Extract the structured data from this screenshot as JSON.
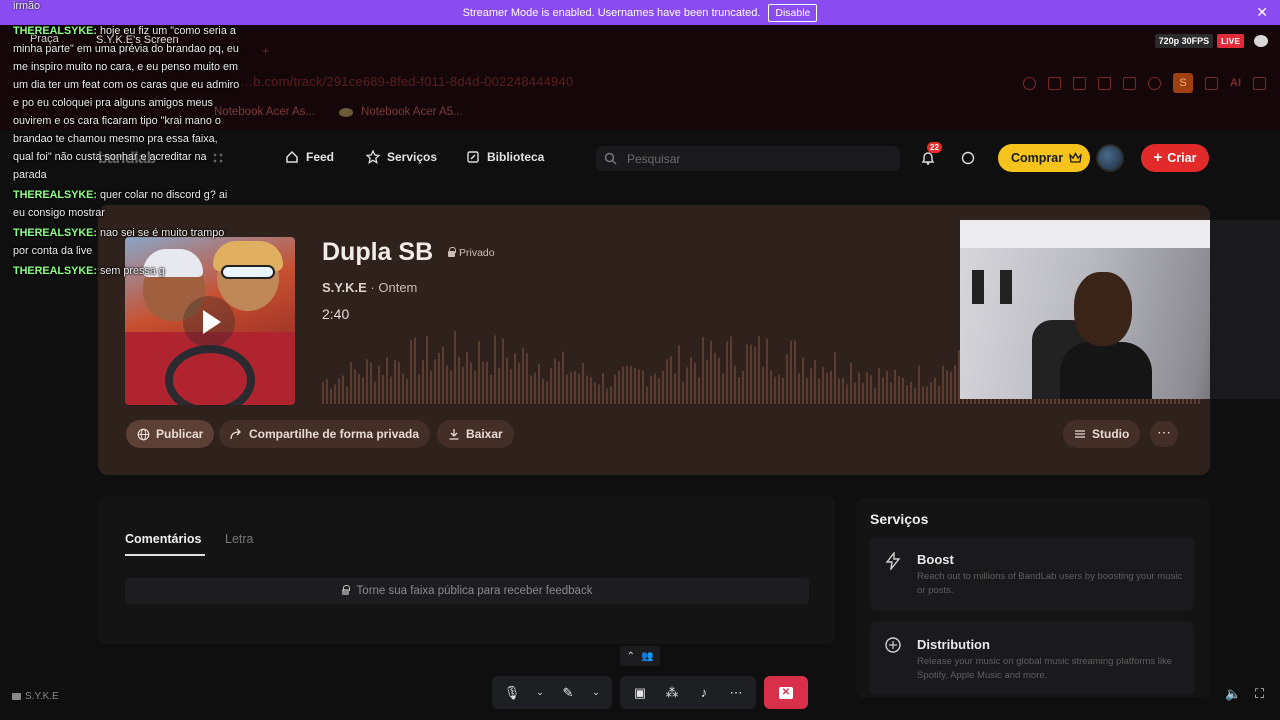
{
  "banner": {
    "message": "Streamer Mode is enabled. Usernames have been truncated.",
    "disable_label": "Disable",
    "close_glyph": "✕"
  },
  "stream": {
    "quality": "720p 30FPS",
    "live": "LIVE",
    "screen_label": "S.Y.K.E's Screen",
    "channel_label": "Praça",
    "user_tag": "S.Y.K.E"
  },
  "browser": {
    "url": "…b.com/track/291ce689-8fed-f011-8d4d-002248444940",
    "bookmarks": [
      "Notebook Acer As...",
      "Notebook Acer A5..."
    ],
    "ai_label": "AI",
    "profile_letter": "S"
  },
  "nav": {
    "logo": "bandlab",
    "links": [
      {
        "label": "Feed",
        "icon": "home-icon"
      },
      {
        "label": "Serviços",
        "icon": "star-icon"
      },
      {
        "label": "Biblioteca",
        "icon": "library-icon"
      }
    ],
    "search_placeholder": "Pesquisar",
    "notification_count": "22",
    "buy_label": "Comprar",
    "create_label": "Criar"
  },
  "track": {
    "title": "Dupla SB",
    "privacy": "Privado",
    "artist": "S.Y.K.E",
    "when": "· Ontem",
    "duration": "2:40",
    "actions": {
      "publish": "Publicar",
      "share_private": "Compartilhe de forma privada",
      "download": "Baixar",
      "studio": "Studio",
      "more": "⋯"
    }
  },
  "comments": {
    "tabs": [
      "Comentários",
      "Letra"
    ],
    "feedback_notice": "Torne sua faixa pública para receber feedback"
  },
  "services": {
    "title": "Serviços",
    "items": [
      {
        "name": "Boost",
        "desc": "Reach out to millions of BandLab users by boosting your music or posts.",
        "icon": "bolt-icon"
      },
      {
        "name": "Distribution",
        "desc": "Release your music on global music streaming platforms like Spotify, Apple Music and more.",
        "icon": "distribution-icon"
      }
    ]
  },
  "chat": {
    "top_fragment": "irmão",
    "messages": [
      {
        "user": "THEREALSYKE:",
        "text": "hoje eu fiz um \"como seria a minha parte\" em uma prévia do brandao pq, eu me inspiro muito no cara, e eu penso muito em um dia ter um feat com os caras que eu admiro e po eu coloquei pra alguns amigos meus ouvirem e os cara ficaram tipo \"krai mano o brandao te chamou mesmo pra essa faixa, qual foi\" não custa sonhar e acreditar na parada"
      },
      {
        "user": "THEREALSYKE:",
        "text": "quer colar no discord g? ai eu consigo mostrar"
      },
      {
        "user": "THEREALSYKE:",
        "text": "nao sei se é muito trampo por conta da live"
      },
      {
        "user": "THEREALSYKE:",
        "text": "sem pressa g"
      }
    ]
  },
  "colors": {
    "banner": "#8a4cf1",
    "card": "#2f211c",
    "buy": "#f5c31c",
    "create": "#e22a2a",
    "chat_user": "#8cff84",
    "end_call": "#d8304a"
  }
}
